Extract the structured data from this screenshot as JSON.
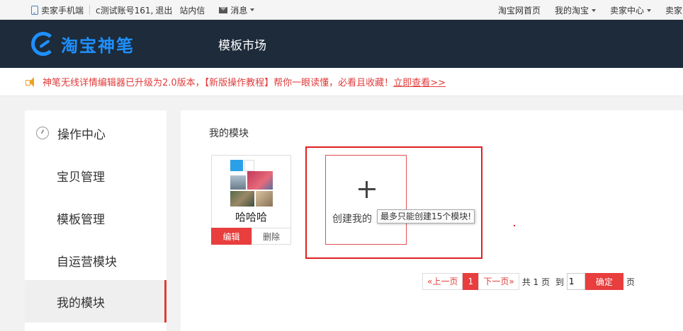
{
  "topbar": {
    "seller_mobile": "卖家手机端",
    "account": "c测试账号161,",
    "logout": "退出",
    "inbox": "站内信",
    "messages": "消息",
    "taobao_home": "淘宝网首页",
    "my_taobao": "我的淘宝",
    "seller_center": "卖家中心",
    "seller_more": "卖家"
  },
  "header": {
    "logo_text": "淘宝神笔",
    "nav_template_market": "模板市场",
    "brand_color": "#1e90ff",
    "background_color": "#1d2b3a"
  },
  "notice": {
    "text": "神笔无线详情编辑器已升级为2.0版本，【新版操作教程】帮你一眼读懂，必看且收藏！",
    "link": "立即查看>>",
    "color": "#e03b3b"
  },
  "sidebar": {
    "header": "操作中心",
    "items": [
      {
        "label": "宝贝管理"
      },
      {
        "label": "模板管理"
      },
      {
        "label": "自运营模块"
      },
      {
        "label": "我的模块",
        "active": true
      }
    ]
  },
  "main": {
    "section_title": "我的模块",
    "module_card": {
      "title": "哈哈哈",
      "edit_label": "编辑",
      "delete_label": "删除"
    },
    "create_card": {
      "label": "创建我的",
      "tooltip": "最多只能创建15个模块!"
    },
    "pager": {
      "prev": "«上一页",
      "current": "1",
      "next": "下一页»",
      "total_prefix": "共",
      "total_pages": "1",
      "total_suffix": "页",
      "goto_prefix": "到",
      "goto_value": "1",
      "confirm": "确定",
      "goto_suffix": "页"
    }
  }
}
